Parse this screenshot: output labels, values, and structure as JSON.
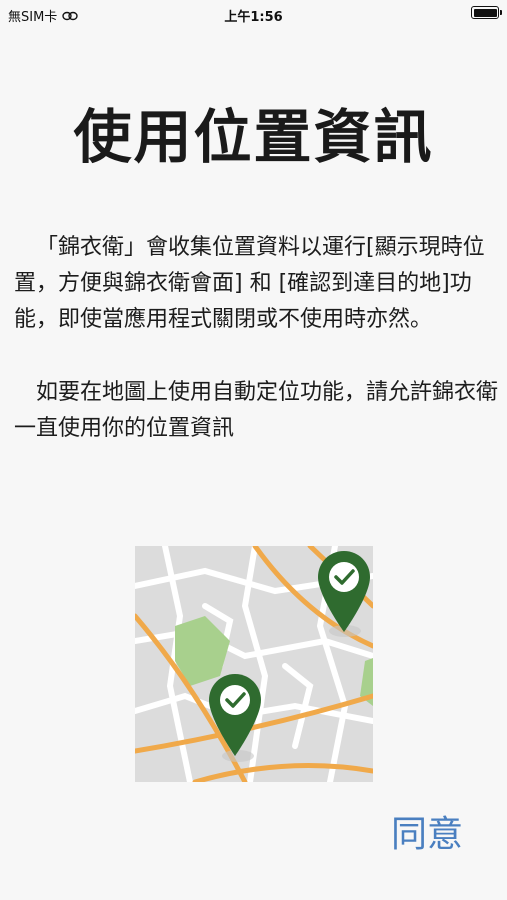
{
  "status_bar": {
    "carrier": "無SIM卡",
    "time": "上午1:56"
  },
  "title": "使用位置資訊",
  "paragraphs": [
    "「錦衣衛」會收集位置資料以運行[顯示現時位置，方便與錦衣衛會面] 和 [確認到達目的地]功能，即使當應用程式關閉或不使用時亦然。",
    "如要在地圖上使用自動定位功能，請允許錦衣衛一直使用你的位置資訊"
  ],
  "agree_button": "同意",
  "colors": {
    "background": "#f7f7f7",
    "accent": "#4a7fc0",
    "pin": "#2f6b2f",
    "road": "#f0a94a",
    "park": "#a8d08d"
  },
  "icons": {
    "link": "link-icon",
    "battery": "battery-icon",
    "map_pin": "map-pin-check-icon"
  }
}
